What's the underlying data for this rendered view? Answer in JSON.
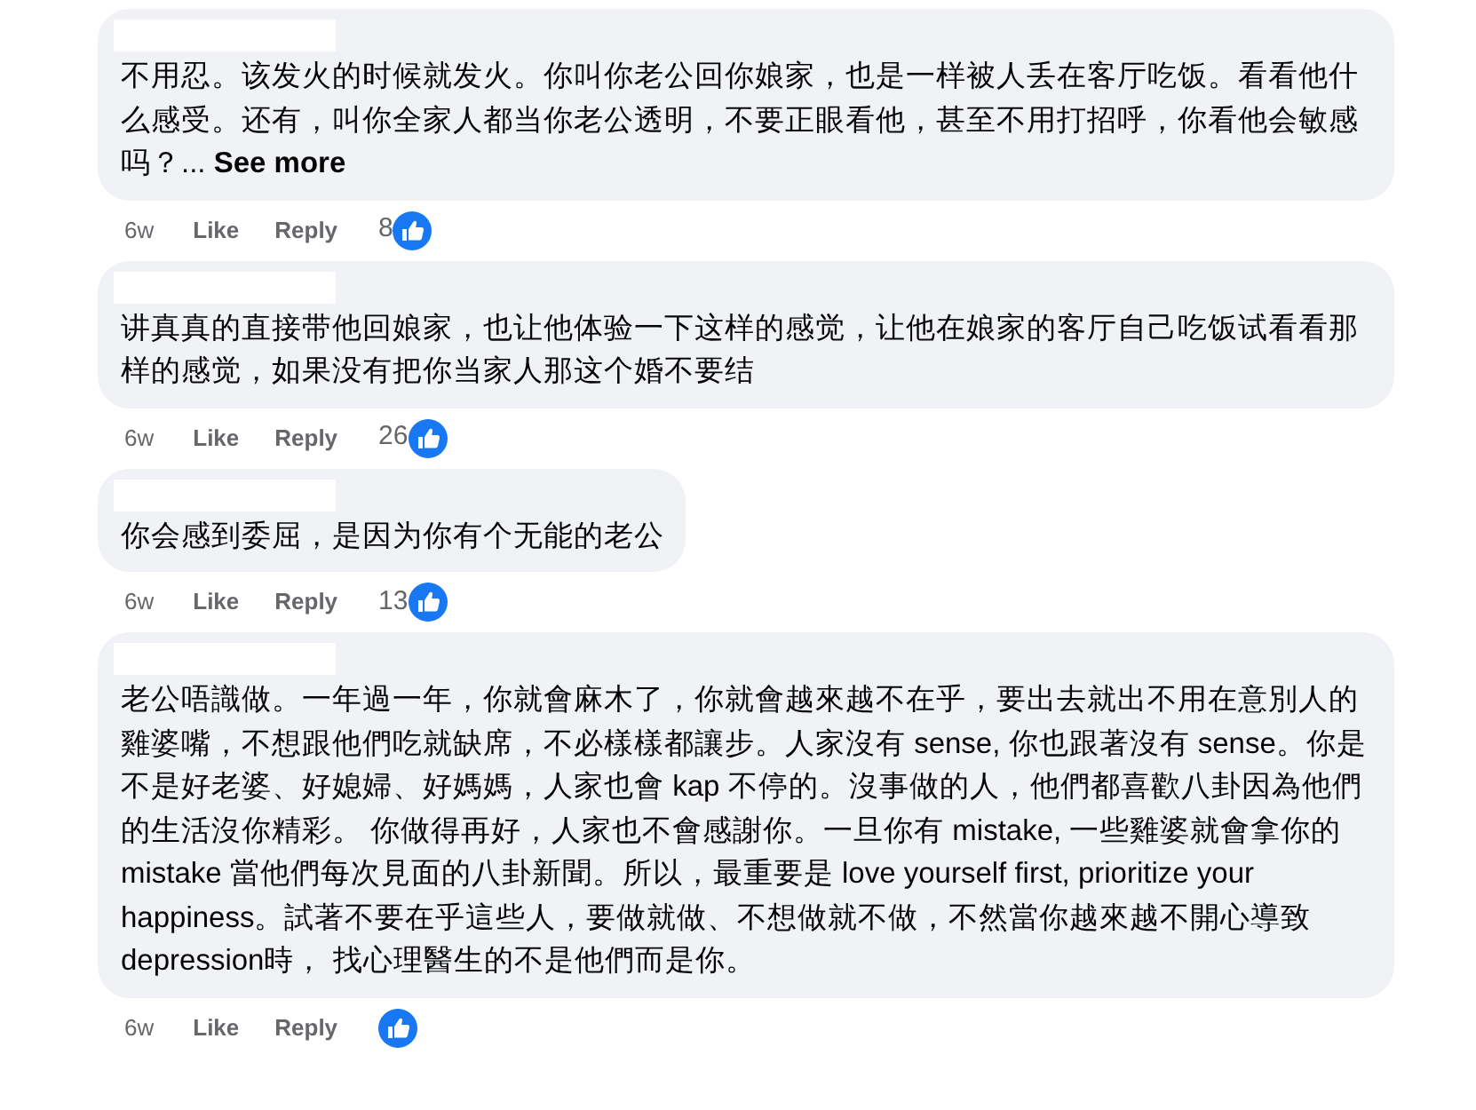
{
  "comments": [
    {
      "text": "不用忍。该发火的时候就发火。你叫你老公回你娘家，也是一样被人丢在客厅吃饭。看看他什么感受。还有，叫你全家人都当你老公透明，不要正眼看他，甚至不用打招呼，你看他会敏感吗？...",
      "see_more": "See more",
      "time": "6w",
      "like": "Like",
      "reply": "Reply",
      "reaction_count": "8"
    },
    {
      "text": "讲真真的直接带他回娘家，也让他体验一下这样的感觉，让他在娘家的客厅自己吃饭试看看那样的感觉，如果没有把你当家人那这个婚不要结",
      "time": "6w",
      "like": "Like",
      "reply": "Reply",
      "reaction_count": "26"
    },
    {
      "text": "你会感到委屈，是因为你有个无能的老公",
      "time": "6w",
      "like": "Like",
      "reply": "Reply",
      "reaction_count": "13"
    },
    {
      "text": "老公唔識做。一年過一年，你就會麻木了，你就會越來越不在乎，要出去就出不用在意別人的雞婆嘴，不想跟他們吃就缺席，不必樣樣都讓步。人家沒有 sense, 你也跟著沒有 sense。你是不是好老婆、好媳婦、好媽媽，人家也會 kap 不停的。沒事做的人，他們都喜歡八卦因為他們的生活沒你精彩。 你做得再好，人家也不會感謝你。一旦你有 mistake, 一些雞婆就會拿你的 mistake 當他們每次見面的八卦新聞。所以，最重要是 love yourself first, prioritize your happiness。試著不要在乎這些人，要做就做、不想做就不做，不然當你越來越不開心導致 depression時， 找心理醫生的不是他們而是你。",
      "time": "6w",
      "like": "Like",
      "reply": "Reply"
    }
  ]
}
